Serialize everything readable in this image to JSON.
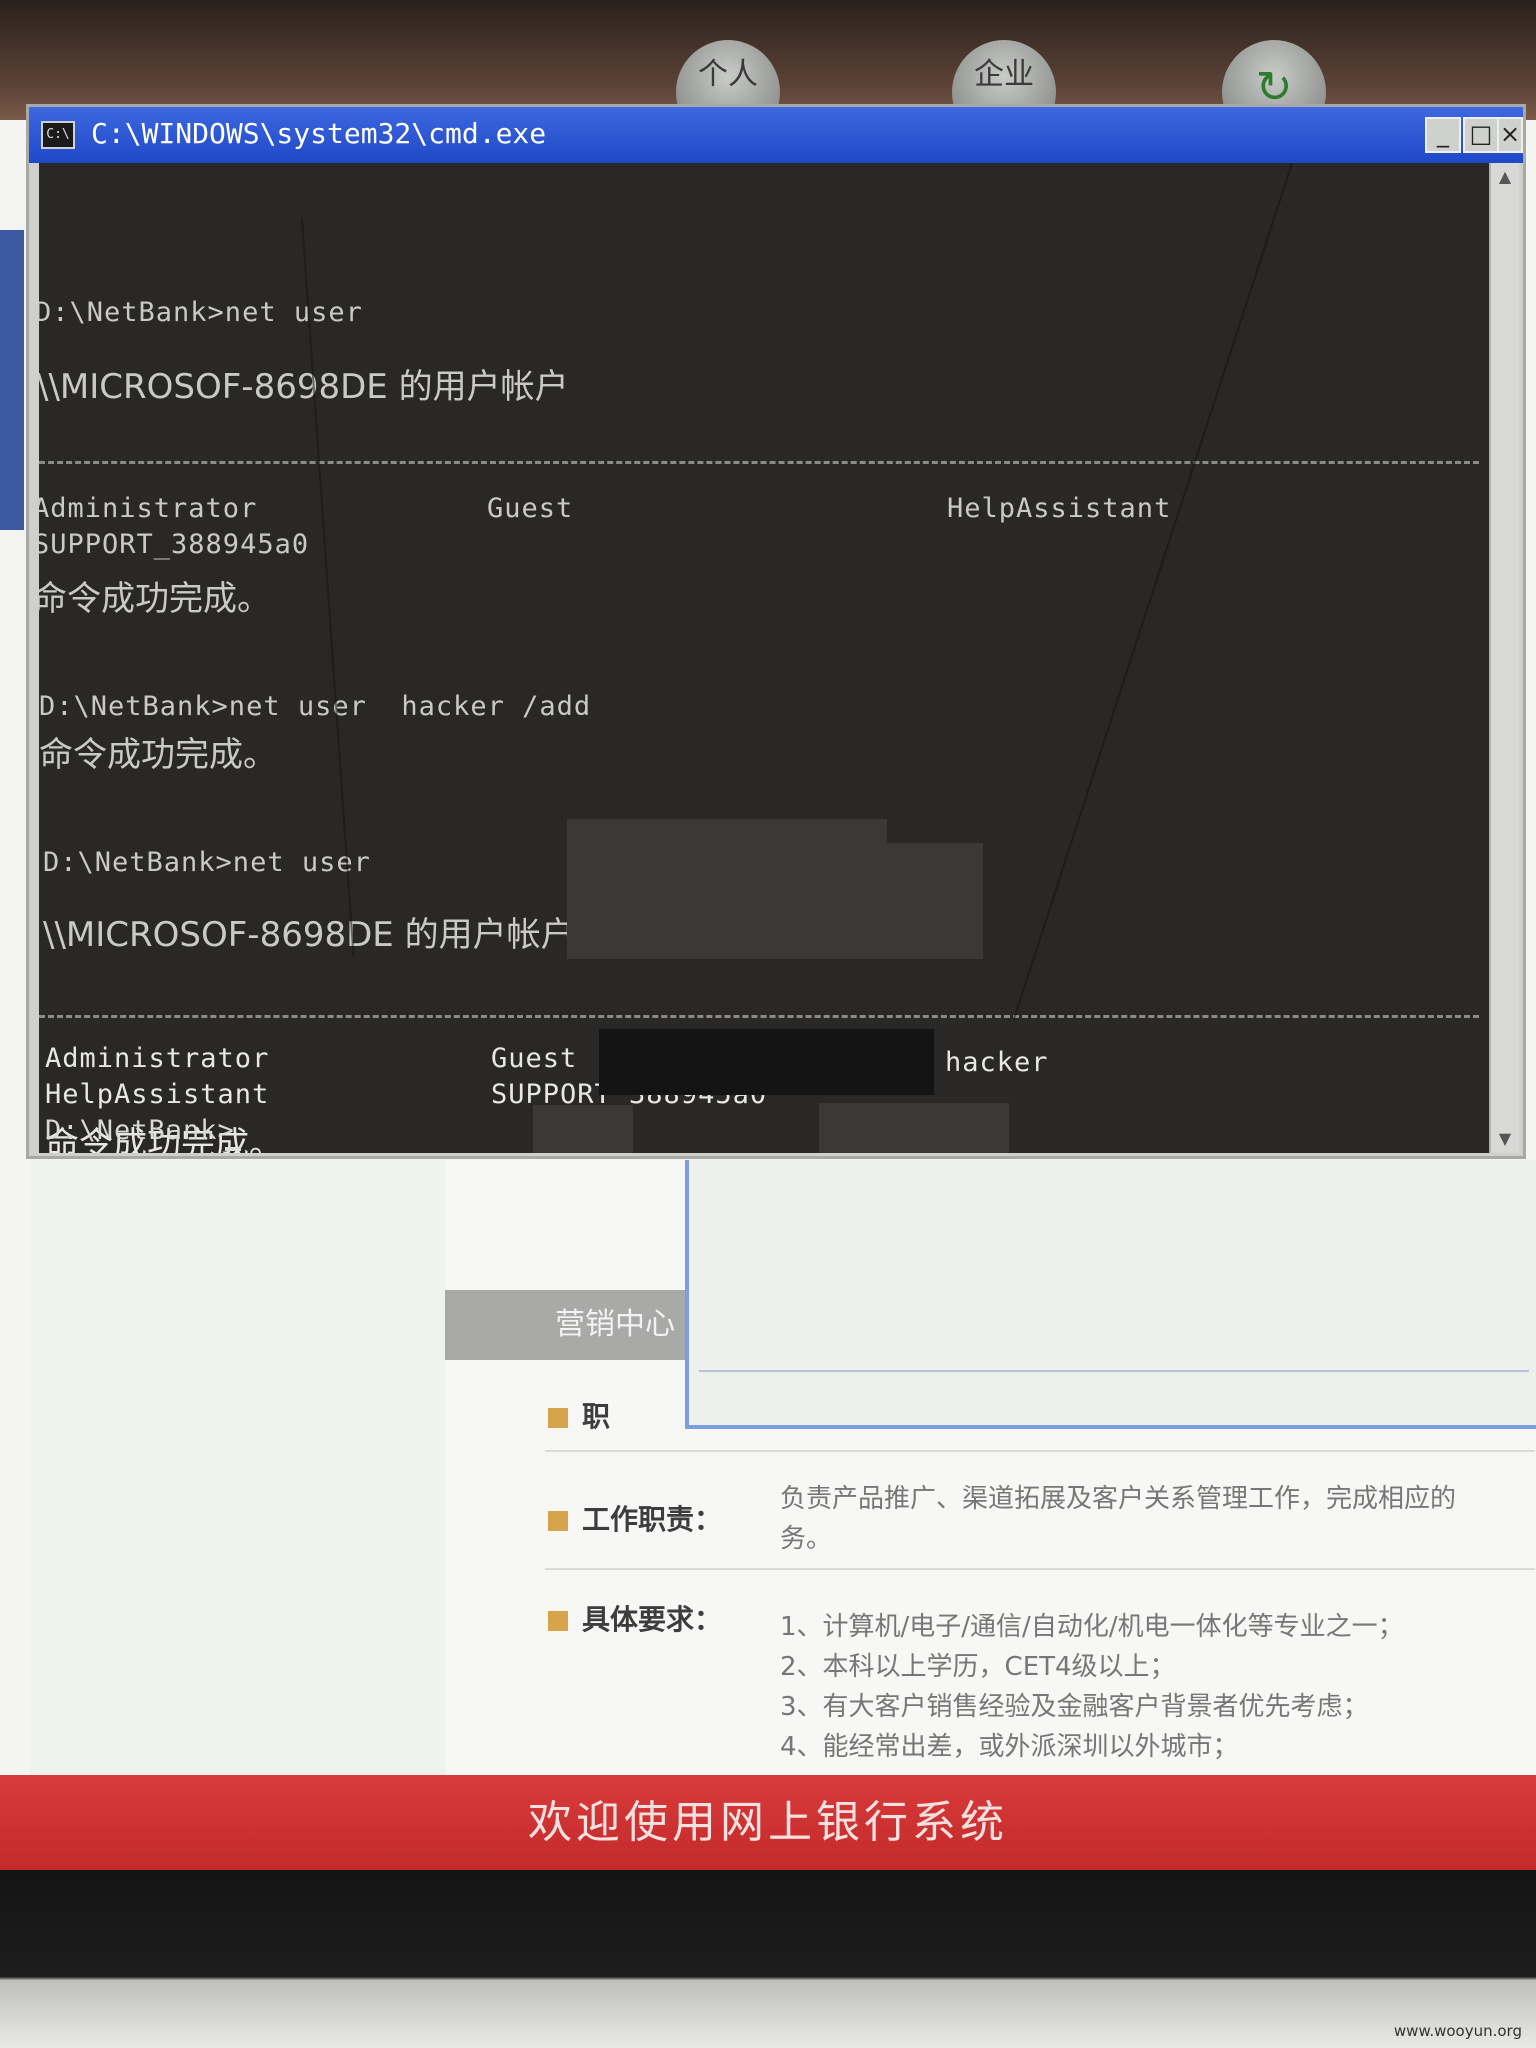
{
  "topbar": {
    "buttons": [
      {
        "label": "个人"
      },
      {
        "label": "企业"
      },
      {
        "label": "↻"
      }
    ]
  },
  "cmd": {
    "title": "C:\\WINDOWS\\system32\\cmd.exe",
    "icon_text": "C:\\",
    "controls": {
      "minimize": "_",
      "maximize": "□",
      "close": "×"
    },
    "scroll": {
      "up": "▲",
      "down": "▼"
    },
    "lines": {
      "l1": "D:\\NetBank>net user",
      "l2": "\\\\MICROSOF-8698DE 的用户帐户",
      "l3_c1": "Administrator",
      "l3_c2": "Guest",
      "l3_c3": "HelpAssistant",
      "l4": "SUPPORT_388945a0",
      "l5": "命令成功完成。",
      "l6": "D:\\NetBank>net user  hacker /add",
      "l7": "命令成功完成。",
      "l8": "D:\\NetBank>net user",
      "l9": "\\\\MICROSOF-8698DE 的用户帐户",
      "l10_c1": "Administrator",
      "l10_c2": "Guest",
      "l10_c3": "hacker",
      "l11_c1": "HelpAssistant",
      "l11_c2": "SUPPORT_388945a0",
      "l12": "命令成功完成。",
      "l13": "D:\\NetBank>"
    }
  },
  "page": {
    "marketing_tab": "营销中心",
    "job": {
      "r1_label": "职",
      "r2_label": "工作职责：",
      "r2_text_1": "负责产品推广、渠道拓展及客户关系管理工作，完成相应的",
      "r2_text_2": "务。",
      "r3_label": "具体要求：",
      "r3_items": [
        "1、计算机/电子/通信/自动化/机电一体化等专业之一；",
        "2、本科以上学历，CET4级以上；",
        "3、有大客户销售经验及金融客户背景者优先考虑；",
        "4、能经常出差，或外派深圳以外城市；"
      ]
    },
    "footer": "欢迎使用网上银行系统"
  },
  "watermark": "www.wooyun.org",
  "colors": {
    "titlebar": "#1f48c8",
    "console_bg": "#2a2826",
    "footer_red": "#c42a2a",
    "bullet": "#d7a44c"
  }
}
